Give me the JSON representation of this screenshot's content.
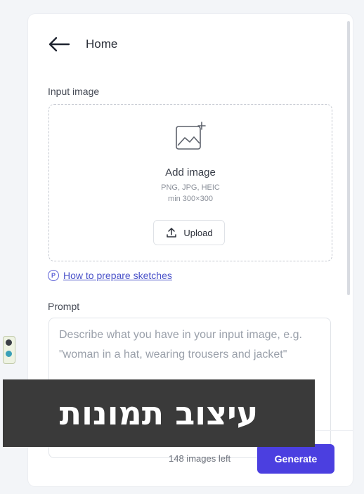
{
  "header": {
    "back_icon": "arrow-left-icon",
    "title": "Home"
  },
  "input_image": {
    "label": "Input image",
    "icon": "add-image-icon",
    "title": "Add image",
    "formats": "PNG, JPG, HEIC",
    "min_size": "min 300×300",
    "upload_label": "Upload",
    "upload_icon": "upload-icon"
  },
  "help_link": {
    "icon": "help-circle-icon",
    "label": "How to prepare sketches"
  },
  "prompt": {
    "label": "Prompt",
    "placeholder": "Describe what you have in your input image, e.g. \"woman in a hat, wearing trousers and jacket\""
  },
  "footer": {
    "images_left": "148 images left",
    "generate_label": "Generate"
  },
  "overlay": {
    "text": "עיצוב תמונות"
  },
  "colors": {
    "accent": "#4b3fe0",
    "link": "#4a52c9",
    "overlay_bg": "#3a3a3a"
  }
}
